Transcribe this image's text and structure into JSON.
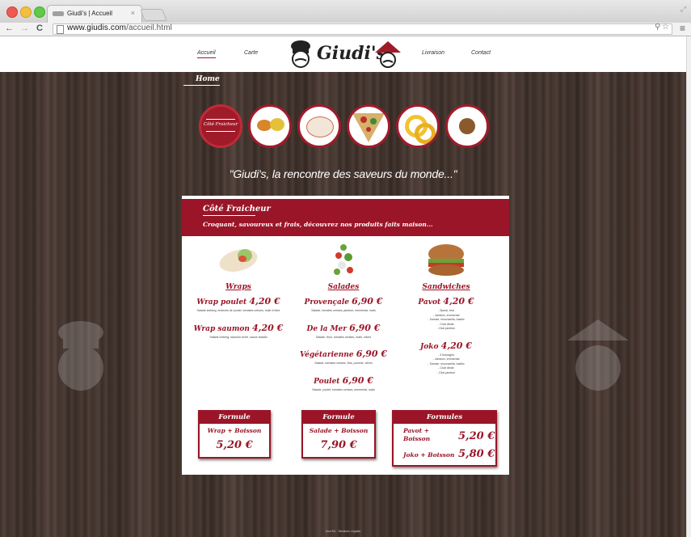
{
  "browser": {
    "tab_title": "Giudi's | Accueil",
    "tab_close": "×",
    "url_host": "www.giudis.com",
    "url_path": "/accueil.html",
    "back": "←",
    "forward": "→",
    "reload": "C",
    "menu": "≡"
  },
  "header": {
    "nav_left": [
      "Accueil",
      "Carte"
    ],
    "nav_right": [
      "Livraison",
      "Contact"
    ],
    "logo_text": "Giudi's"
  },
  "page": {
    "home_title": "Home",
    "tagline": "\"Giudi's, la rencontre des saveurs du monde...\"",
    "category_active": "Côté Fraicheur"
  },
  "panel": {
    "title": "Côté Fraicheur",
    "subtitle": "Croquant, savoureux et frais, découvrez nos produits faits maison...",
    "columns": [
      {
        "heading": "Wraps",
        "items": [
          {
            "name": "Wrap poulet",
            "price": "4,20 €",
            "desc": "Salade iceberg, émincés de poulet, tomates cerises, huile d'olive"
          },
          {
            "name": "Wrap saumon",
            "price": "4,20 €",
            "desc": "Salade iceberg, saumon fumé, sauce tzatziki"
          }
        ]
      },
      {
        "heading": "Salades",
        "items": [
          {
            "name": "Provençale",
            "price": "6,90 €",
            "desc": "Salade, tomates cerises, jambon, emmental, maïs"
          },
          {
            "name": "De la Mer",
            "price": "6,90 €",
            "desc": "Salade, thon, tomates cerises, maïs, olives"
          },
          {
            "name": "Végétarienne",
            "price": "6,90 €",
            "desc": "Salade, tomates cerises, feta, pomme, olives"
          },
          {
            "name": "Poulet",
            "price": "6,90 €",
            "desc": "Salade, poulet, tomates cerises, emmental, maïs"
          }
        ]
      },
      {
        "heading": "Sandwiches",
        "items": [
          {
            "name": "Pavot",
            "price": "4,20 €",
            "desc": "- Speck, brie\n- Jambon, emmental\n- Tomate, mozzarella, basilic\n- Club dinde\n- Club jambon"
          },
          {
            "name": "Joko",
            "price": "4,20 €",
            "desc": "- 3 fromages\n- Jambon, emmental\n- Tomate, mozzarella, basilic\n- Club dinde\n- Club jambon"
          }
        ]
      }
    ],
    "formules": [
      {
        "title": "Formule",
        "line": "Wrap + Boisson",
        "price": "5,20 €"
      },
      {
        "title": "Formule",
        "line": "Salade + Boisson",
        "price": "7,90 €"
      },
      {
        "title": "Formules",
        "line1": "Pavot + Boisson",
        "price1": "5,20 €",
        "line2": "Joko + Boisson",
        "price2": "5,80 €"
      }
    ]
  },
  "footer": {
    "text": "Kreo'ML · Mentions Légales"
  },
  "colors": {
    "accent": "#9a1527",
    "wood": "#3e302a"
  }
}
